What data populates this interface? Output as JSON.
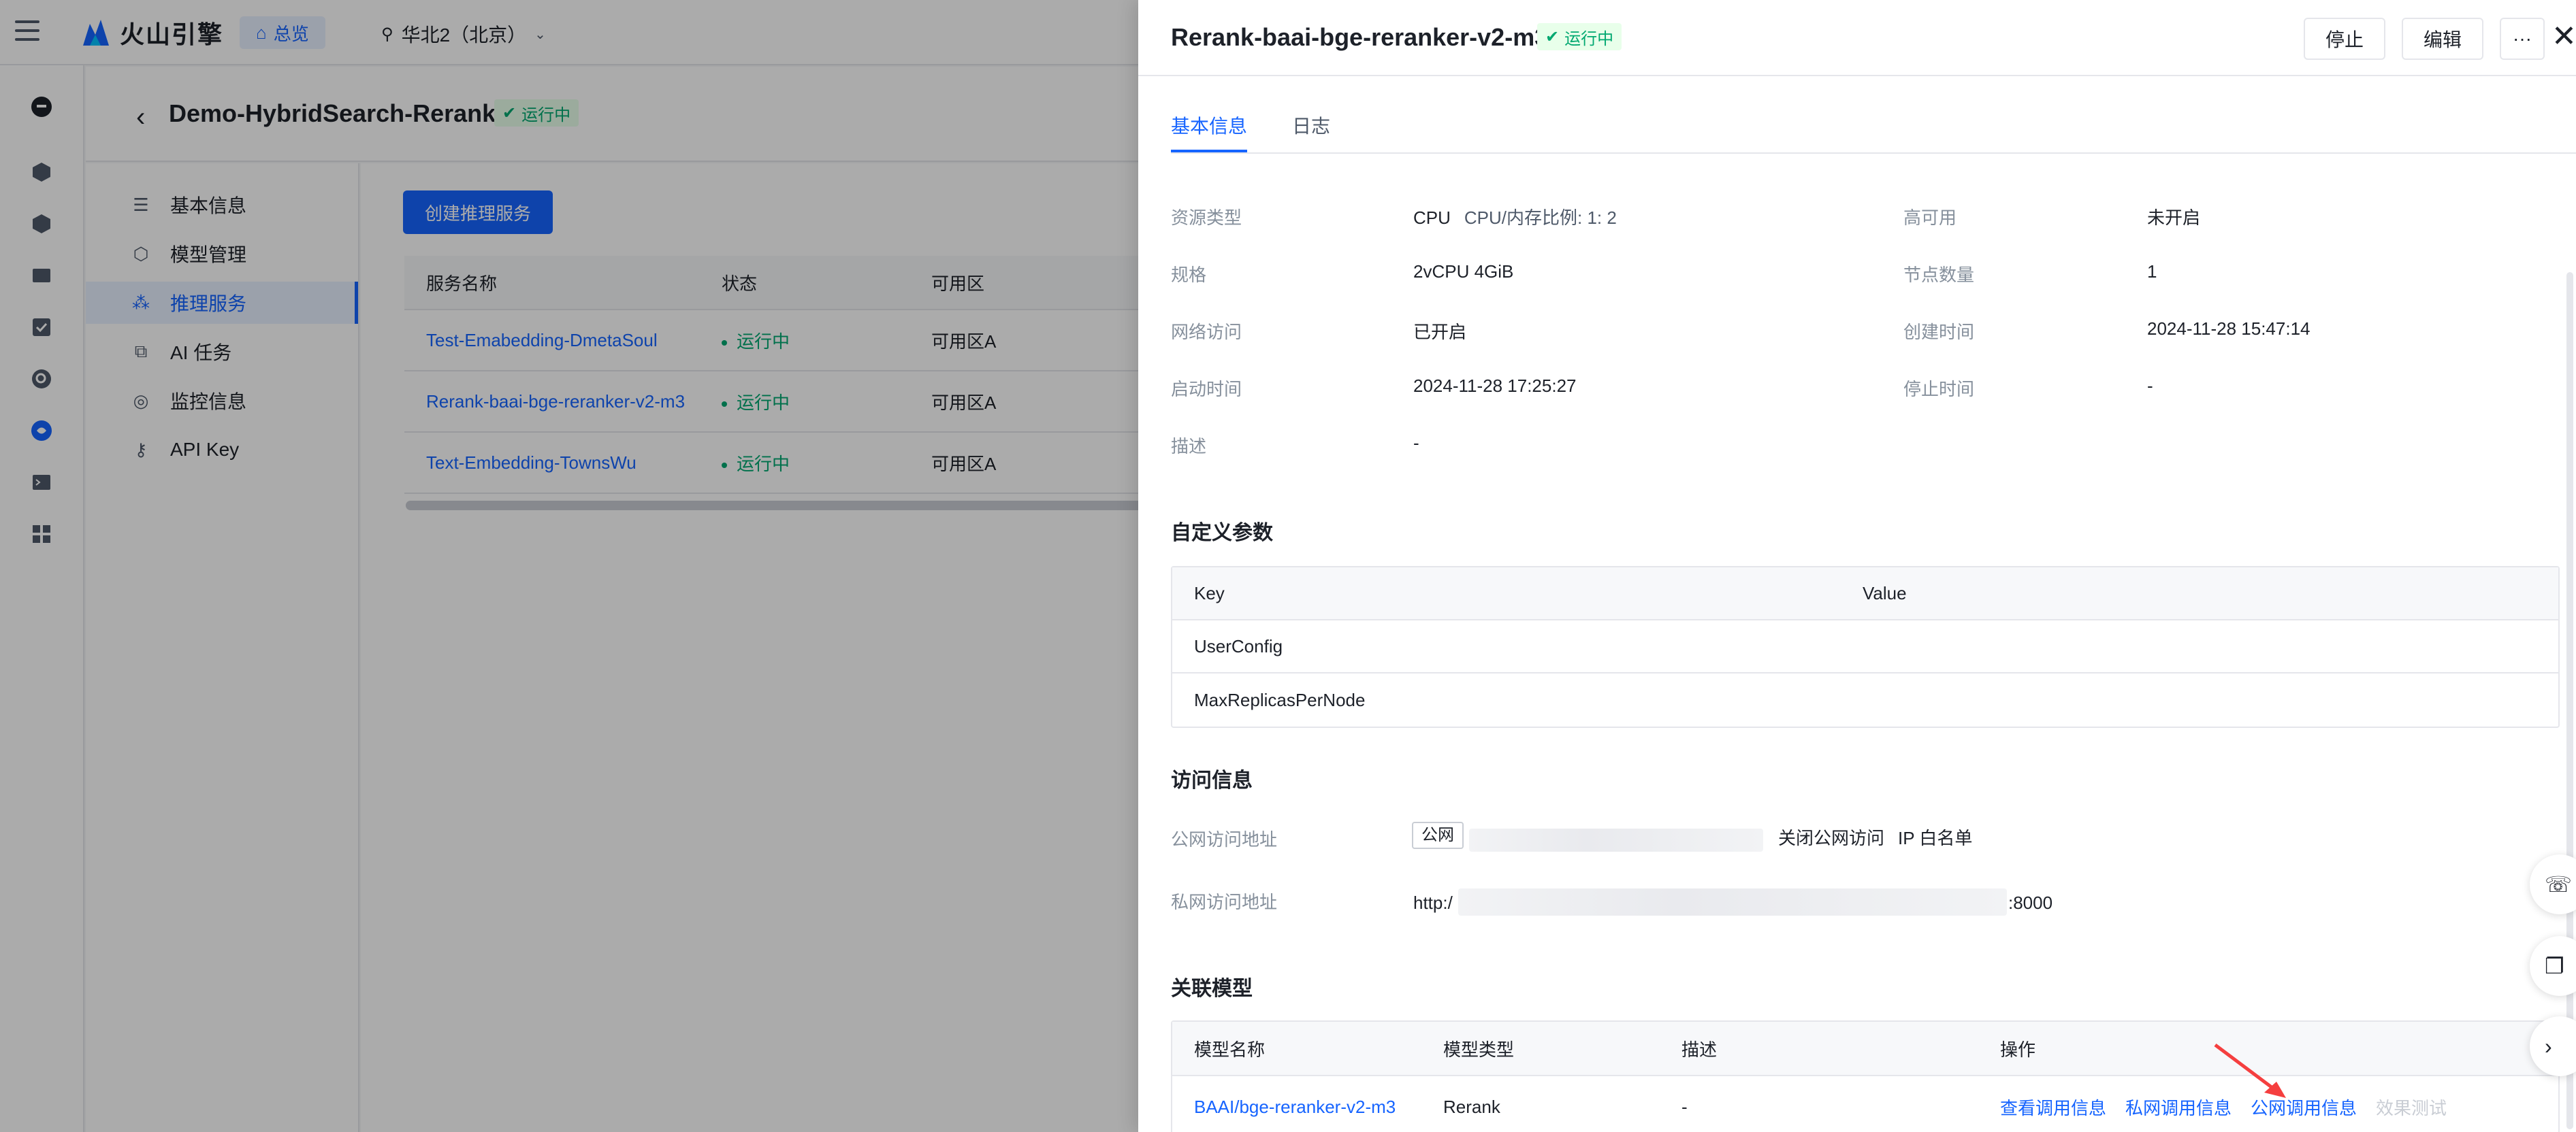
{
  "topbar": {
    "brand": "火山引擎",
    "home_label": "总览",
    "region": "华北2（北京）"
  },
  "rail_icons": [
    "chat-icon",
    "cube-icon",
    "cube-icon",
    "folder-icon",
    "check-icon",
    "search-icon",
    "brain-icon",
    "terminal-icon",
    "grid-icon"
  ],
  "page": {
    "title": "Demo-HybridSearch-Rerank",
    "status": "运行中"
  },
  "leftnav": {
    "items": [
      {
        "label": "基本信息",
        "icon": "list-icon"
      },
      {
        "label": "模型管理",
        "icon": "cube-icon"
      },
      {
        "label": "推理服务",
        "icon": "nodes-icon"
      },
      {
        "label": "AI 任务",
        "icon": "stack-icon"
      },
      {
        "label": "监控信息",
        "icon": "monitor-icon"
      },
      {
        "label": "API Key",
        "icon": "key-icon"
      }
    ]
  },
  "services": {
    "create_label": "创建推理服务",
    "columns": [
      "服务名称",
      "状态",
      "可用区"
    ],
    "rows": [
      {
        "name": "Test-Emabedding-DmetaSoul",
        "status": "运行中",
        "zone": "可用区A"
      },
      {
        "name": "Rerank-baai-bge-reranker-v2-m3",
        "status": "运行中",
        "zone": "可用区A"
      },
      {
        "name": "Text-Embedding-TownsWu",
        "status": "运行中",
        "zone": "可用区A"
      }
    ]
  },
  "drawer": {
    "title": "Rerank-baai-bge-reranker-v2-m3",
    "status": "运行中",
    "stop_label": "停止",
    "edit_label": "编辑",
    "more_label": "···",
    "tabs": [
      "基本信息",
      "日志"
    ],
    "basic": {
      "resource_type_label": "资源类型",
      "resource_type_value": "CPU",
      "resource_type_ratio": "CPU/内存比例: 1: 2",
      "spec_label": "规格",
      "spec_value": "2vCPU 4GiB",
      "network_label": "网络访问",
      "network_value": "已开启",
      "start_time_label": "启动时间",
      "start_time_value": "2024-11-28 17:25:27",
      "desc_label": "描述",
      "desc_value": "-",
      "ha_label": "高可用",
      "ha_value": "未开启",
      "nodes_label": "节点数量",
      "nodes_value": "1",
      "created_label": "创建时间",
      "created_value": "2024-11-28 15:47:14",
      "stop_time_label": "停止时间",
      "stop_time_value": "-"
    },
    "custom_params": {
      "title": "自定义参数",
      "key_header": "Key",
      "value_header": "Value",
      "rows": [
        {
          "key": "UserConfig",
          "value": ""
        },
        {
          "key": "MaxReplicasPerNode",
          "value": ""
        }
      ]
    },
    "access": {
      "title": "访问信息",
      "public_label": "公网访问地址",
      "public_tag": "公网",
      "close_public": "关闭公网访问",
      "ip_whitelist": "IP 白名单",
      "private_label": "私网访问地址",
      "private_prefix": "http:/",
      "private_suffix": ":8000"
    },
    "models": {
      "title": "关联模型",
      "headers": [
        "模型名称",
        "模型类型",
        "描述",
        "操作"
      ],
      "rows": [
        {
          "name": "BAAI/bge-reranker-v2-m3",
          "type": "Rerank",
          "desc": "-",
          "ops": [
            "查看调用信息",
            "私网调用信息",
            "公网调用信息",
            "效果测试"
          ]
        }
      ]
    }
  },
  "colors": {
    "primary": "#1664ff",
    "success": "#00a870",
    "arrow": "#f53f3f"
  }
}
